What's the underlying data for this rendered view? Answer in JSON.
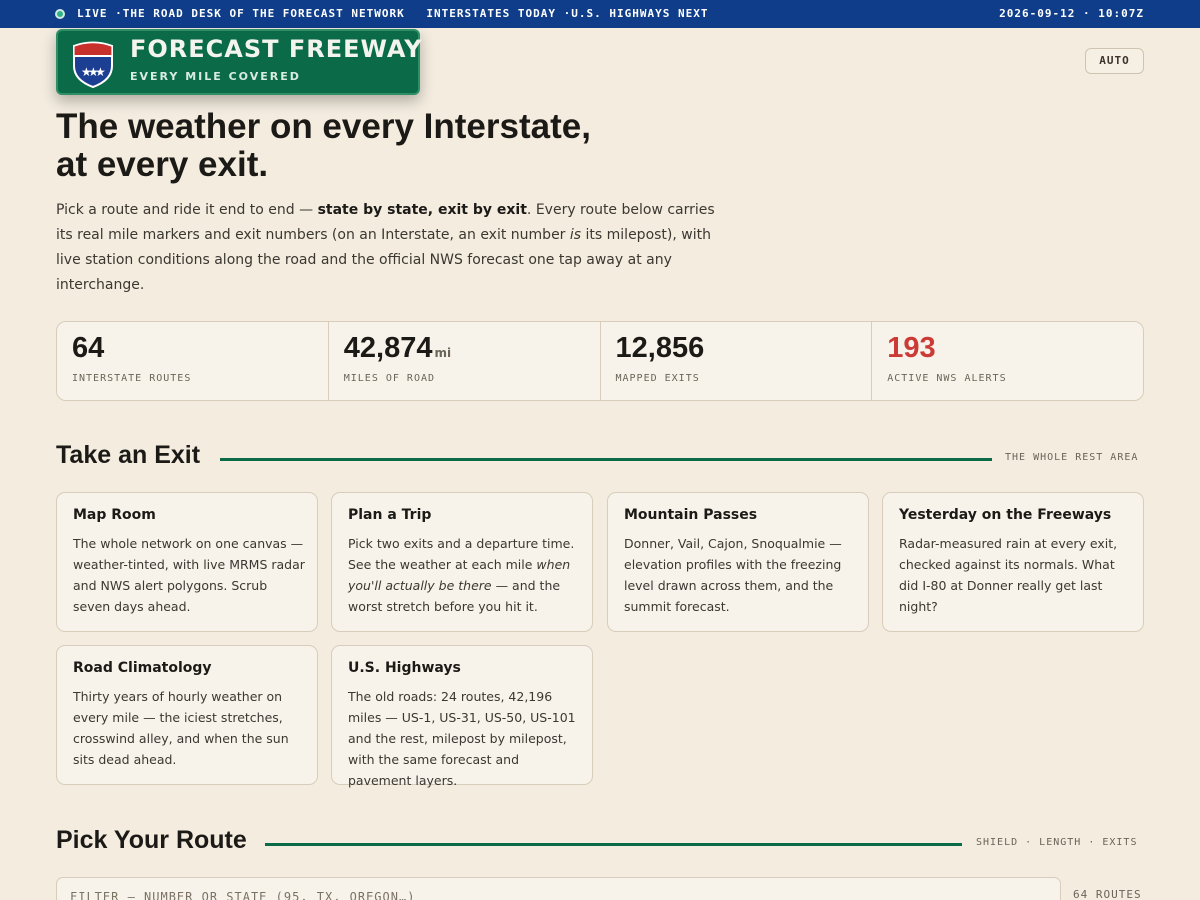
{
  "topbar": {
    "ticker_1": "LIVE ·THE ROAD DESK OF THE FORECAST NETWORK",
    "ticker_2": "INTERSTATES TODAY ·U.S. HIGHWAYS NEXT",
    "clock": "2026-09-12 · 10:07Z"
  },
  "sign": {
    "title": "FORECAST FREEWAY",
    "subtitle": "EVERY MILE COVERED",
    "shield_icon": "interstate-shield-icon",
    "colors": {
      "sign_green": "#0b6b48",
      "shield_red": "#c8302c",
      "shield_blue": "#1c3f94"
    }
  },
  "header": {
    "auto_label": "AUTO"
  },
  "hero": {
    "title_line_1": "The weather on every Interstate,",
    "title_line_2": "at every exit.",
    "intro_1": "Pick a route and ride it end to end — ",
    "intro_bold": "state by state, exit by exit",
    "intro_2": ". Every route below carries its real mile markers and exit numbers (on an Interstate, an exit number ",
    "intro_em": "is",
    "intro_3": " its milepost), with live station conditions along the road and the official NWS forecast one tap away at any interchange."
  },
  "stats": [
    {
      "value": "64",
      "unit": "",
      "label": "INTERSTATE ROUTES"
    },
    {
      "value": "42,874",
      "unit": "mi",
      "label": "MILES OF ROAD"
    },
    {
      "value": "12,856",
      "unit": "",
      "label": "MAPPED EXITS"
    },
    {
      "value": "193",
      "unit": "",
      "label": "ACTIVE NWS ALERTS",
      "color": "#cc3a36"
    }
  ],
  "exit_section": {
    "title": "Take an Exit",
    "meta": "THE WHOLE REST AREA",
    "cards": [
      {
        "title": "Map Room",
        "body": "The whole network on one canvas — weather-tinted, with live MRMS radar and NWS alert polygons. Scrub seven days ahead."
      },
      {
        "title": "Plan a Trip",
        "body_1": "Pick two exits and a departure time. See the weather at each mile ",
        "body_em": "when you'll actually be there",
        "body_2": " — and the worst stretch before you hit it."
      },
      {
        "title": "Mountain Passes",
        "body": "Donner, Vail, Cajon, Snoqualmie — elevation profiles with the freezing level drawn across them, and the summit forecast."
      },
      {
        "title": "Yesterday on the Freeways",
        "body": "Radar-measured rain at every exit, checked against its normals. What did I-80 at Donner really get last night?"
      },
      {
        "title": "Road Climatology",
        "body": "Thirty years of hourly weather on every mile — the iciest stretches, crosswind alley, and when the sun sits dead ahead."
      },
      {
        "title": "U.S. Highways",
        "body": "The old roads: 24 routes, 42,196 miles — US-1, US-31, US-50, US-101 and the rest, milepost by milepost, with the same forecast and pavement layers."
      }
    ]
  },
  "route_section": {
    "title": "Pick Your Route",
    "meta": "SHIELD · LENGTH · EXITS",
    "filter_placeholder": "FILTER — NUMBER OR STATE (95, TX, OREGON…)",
    "count": "64 ROUTES"
  }
}
